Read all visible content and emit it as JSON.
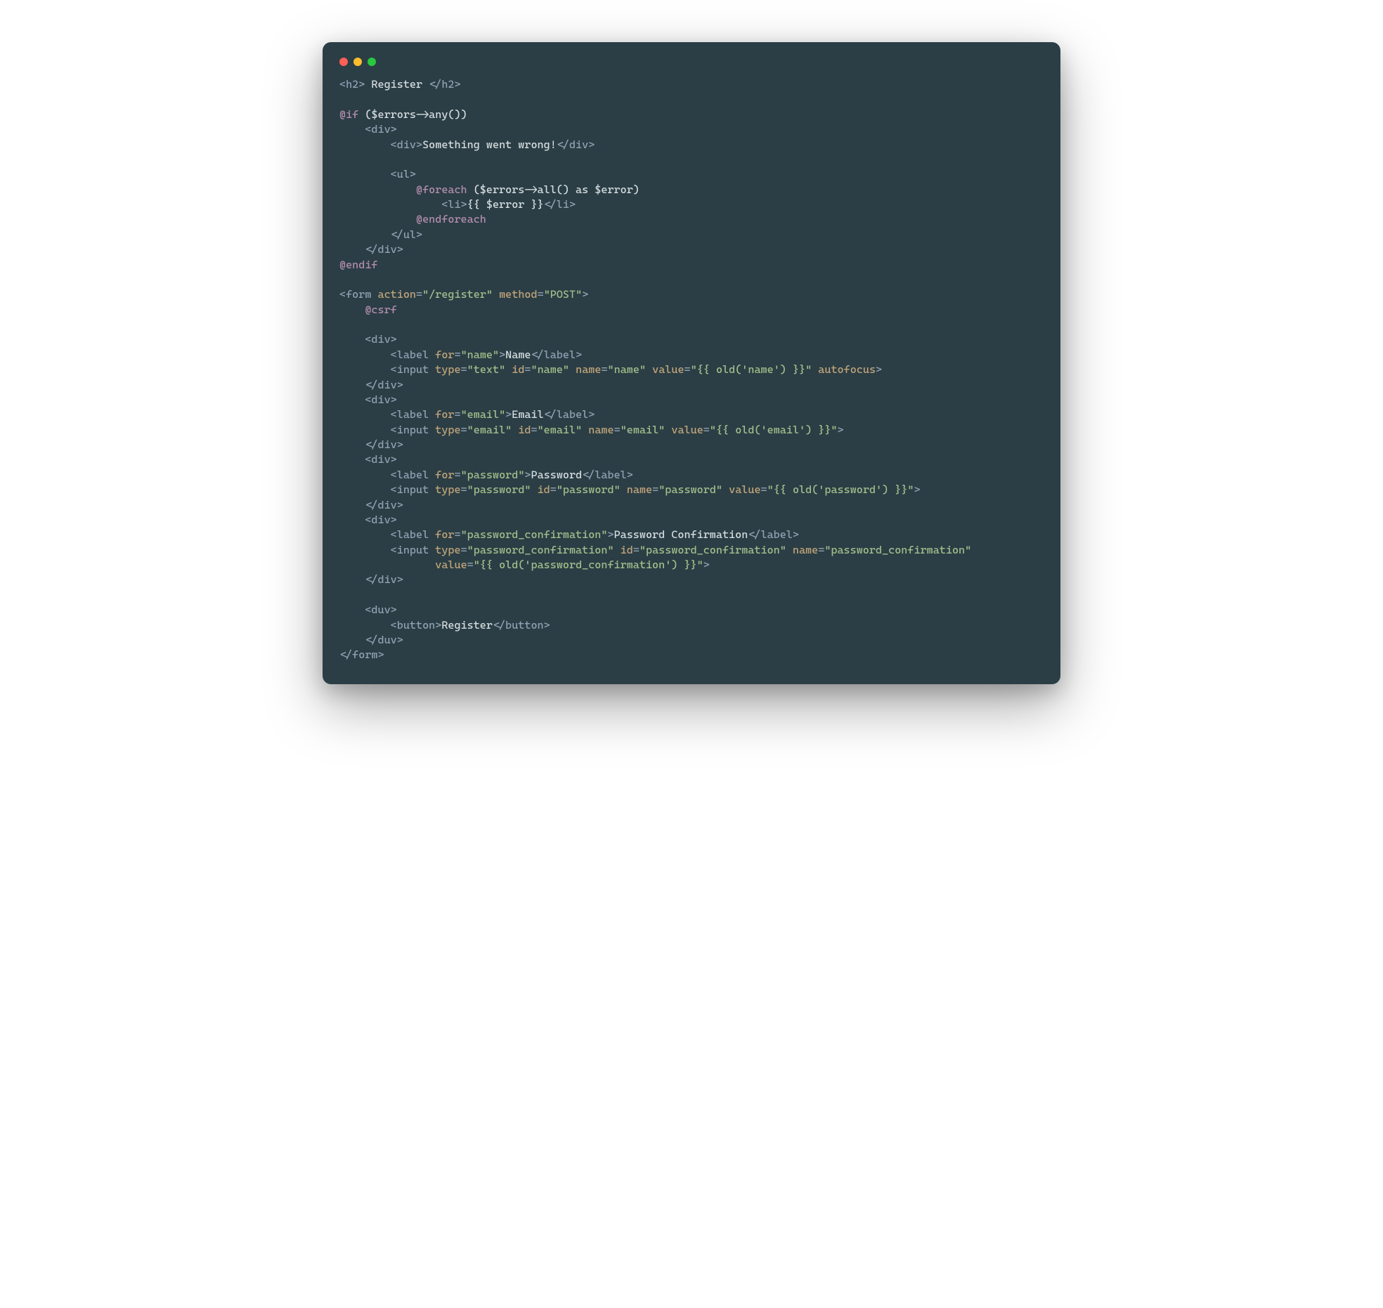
{
  "tokens": [
    [
      {
        "c": "tag",
        "t": "<h2>"
      },
      {
        "c": "txt",
        "t": " Register "
      },
      {
        "c": "tag",
        "t": "</h2>"
      }
    ],
    [],
    [
      {
        "c": "dir",
        "t": "@if"
      },
      {
        "c": "txt",
        "t": " ($errors->any())"
      }
    ],
    [
      {
        "c": "txt",
        "t": "    "
      },
      {
        "c": "tag",
        "t": "<div>"
      }
    ],
    [
      {
        "c": "txt",
        "t": "        "
      },
      {
        "c": "tag",
        "t": "<div>"
      },
      {
        "c": "txt",
        "t": "Something went wrong!"
      },
      {
        "c": "tag",
        "t": "</div>"
      }
    ],
    [],
    [
      {
        "c": "txt",
        "t": "        "
      },
      {
        "c": "tag",
        "t": "<ul>"
      }
    ],
    [
      {
        "c": "txt",
        "t": "            "
      },
      {
        "c": "dir",
        "t": "@foreach"
      },
      {
        "c": "txt",
        "t": " ($errors->all() as $error)"
      }
    ],
    [
      {
        "c": "txt",
        "t": "                "
      },
      {
        "c": "tag",
        "t": "<li>"
      },
      {
        "c": "txt",
        "t": "{{ $error }}"
      },
      {
        "c": "tag",
        "t": "</li>"
      }
    ],
    [
      {
        "c": "txt",
        "t": "            "
      },
      {
        "c": "dir",
        "t": "@endforeach"
      }
    ],
    [
      {
        "c": "txt",
        "t": "        "
      },
      {
        "c": "tag",
        "t": "</ul>"
      }
    ],
    [
      {
        "c": "txt",
        "t": "    "
      },
      {
        "c": "tag",
        "t": "</div>"
      }
    ],
    [
      {
        "c": "dir",
        "t": "@endif"
      }
    ],
    [],
    [
      {
        "c": "tag",
        "t": "<form "
      },
      {
        "c": "attr",
        "t": "action"
      },
      {
        "c": "tag",
        "t": "="
      },
      {
        "c": "str",
        "t": "\"/register\""
      },
      {
        "c": "tag",
        "t": " "
      },
      {
        "c": "attr",
        "t": "method"
      },
      {
        "c": "tag",
        "t": "="
      },
      {
        "c": "str",
        "t": "\"POST\""
      },
      {
        "c": "tag",
        "t": ">"
      }
    ],
    [
      {
        "c": "txt",
        "t": "    "
      },
      {
        "c": "dir",
        "t": "@csrf"
      }
    ],
    [],
    [
      {
        "c": "txt",
        "t": "    "
      },
      {
        "c": "tag",
        "t": "<div>"
      }
    ],
    [
      {
        "c": "txt",
        "t": "        "
      },
      {
        "c": "tag",
        "t": "<label "
      },
      {
        "c": "attr",
        "t": "for"
      },
      {
        "c": "tag",
        "t": "="
      },
      {
        "c": "str",
        "t": "\"name\""
      },
      {
        "c": "tag",
        "t": ">"
      },
      {
        "c": "txt",
        "t": "Name"
      },
      {
        "c": "tag",
        "t": "</label>"
      }
    ],
    [
      {
        "c": "txt",
        "t": "        "
      },
      {
        "c": "tag",
        "t": "<input "
      },
      {
        "c": "attr",
        "t": "type"
      },
      {
        "c": "tag",
        "t": "="
      },
      {
        "c": "str",
        "t": "\"text\""
      },
      {
        "c": "tag",
        "t": " "
      },
      {
        "c": "attr",
        "t": "id"
      },
      {
        "c": "tag",
        "t": "="
      },
      {
        "c": "str",
        "t": "\"name\""
      },
      {
        "c": "tag",
        "t": " "
      },
      {
        "c": "attr",
        "t": "name"
      },
      {
        "c": "tag",
        "t": "="
      },
      {
        "c": "str",
        "t": "\"name\""
      },
      {
        "c": "tag",
        "t": " "
      },
      {
        "c": "attr",
        "t": "value"
      },
      {
        "c": "tag",
        "t": "="
      },
      {
        "c": "str",
        "t": "\"{{ old('name') }}\""
      },
      {
        "c": "tag",
        "t": " "
      },
      {
        "c": "attr",
        "t": "autofocus"
      },
      {
        "c": "tag",
        "t": ">"
      }
    ],
    [
      {
        "c": "txt",
        "t": "    "
      },
      {
        "c": "tag",
        "t": "</div>"
      }
    ],
    [
      {
        "c": "txt",
        "t": "    "
      },
      {
        "c": "tag",
        "t": "<div>"
      }
    ],
    [
      {
        "c": "txt",
        "t": "        "
      },
      {
        "c": "tag",
        "t": "<label "
      },
      {
        "c": "attr",
        "t": "for"
      },
      {
        "c": "tag",
        "t": "="
      },
      {
        "c": "str",
        "t": "\"email\""
      },
      {
        "c": "tag",
        "t": ">"
      },
      {
        "c": "txt",
        "t": "Email"
      },
      {
        "c": "tag",
        "t": "</label>"
      }
    ],
    [
      {
        "c": "txt",
        "t": "        "
      },
      {
        "c": "tag",
        "t": "<input "
      },
      {
        "c": "attr",
        "t": "type"
      },
      {
        "c": "tag",
        "t": "="
      },
      {
        "c": "str",
        "t": "\"email\""
      },
      {
        "c": "tag",
        "t": " "
      },
      {
        "c": "attr",
        "t": "id"
      },
      {
        "c": "tag",
        "t": "="
      },
      {
        "c": "str",
        "t": "\"email\""
      },
      {
        "c": "tag",
        "t": " "
      },
      {
        "c": "attr",
        "t": "name"
      },
      {
        "c": "tag",
        "t": "="
      },
      {
        "c": "str",
        "t": "\"email\""
      },
      {
        "c": "tag",
        "t": " "
      },
      {
        "c": "attr",
        "t": "value"
      },
      {
        "c": "tag",
        "t": "="
      },
      {
        "c": "str",
        "t": "\"{{ old('email') }}\""
      },
      {
        "c": "tag",
        "t": ">"
      }
    ],
    [
      {
        "c": "txt",
        "t": "    "
      },
      {
        "c": "tag",
        "t": "</div>"
      }
    ],
    [
      {
        "c": "txt",
        "t": "    "
      },
      {
        "c": "tag",
        "t": "<div>"
      }
    ],
    [
      {
        "c": "txt",
        "t": "        "
      },
      {
        "c": "tag",
        "t": "<label "
      },
      {
        "c": "attr",
        "t": "for"
      },
      {
        "c": "tag",
        "t": "="
      },
      {
        "c": "str",
        "t": "\"password\""
      },
      {
        "c": "tag",
        "t": ">"
      },
      {
        "c": "txt",
        "t": "Password"
      },
      {
        "c": "tag",
        "t": "</label>"
      }
    ],
    [
      {
        "c": "txt",
        "t": "        "
      },
      {
        "c": "tag",
        "t": "<input "
      },
      {
        "c": "attr",
        "t": "type"
      },
      {
        "c": "tag",
        "t": "="
      },
      {
        "c": "str",
        "t": "\"password\""
      },
      {
        "c": "tag",
        "t": " "
      },
      {
        "c": "attr",
        "t": "id"
      },
      {
        "c": "tag",
        "t": "="
      },
      {
        "c": "str",
        "t": "\"password\""
      },
      {
        "c": "tag",
        "t": " "
      },
      {
        "c": "attr",
        "t": "name"
      },
      {
        "c": "tag",
        "t": "="
      },
      {
        "c": "str",
        "t": "\"password\""
      },
      {
        "c": "tag",
        "t": " "
      },
      {
        "c": "attr",
        "t": "value"
      },
      {
        "c": "tag",
        "t": "="
      },
      {
        "c": "str",
        "t": "\"{{ old('password') }}\""
      },
      {
        "c": "tag",
        "t": ">"
      }
    ],
    [
      {
        "c": "txt",
        "t": "    "
      },
      {
        "c": "tag",
        "t": "</div>"
      }
    ],
    [
      {
        "c": "txt",
        "t": "    "
      },
      {
        "c": "tag",
        "t": "<div>"
      }
    ],
    [
      {
        "c": "txt",
        "t": "        "
      },
      {
        "c": "tag",
        "t": "<label "
      },
      {
        "c": "attr",
        "t": "for"
      },
      {
        "c": "tag",
        "t": "="
      },
      {
        "c": "str",
        "t": "\"password_confirmation\""
      },
      {
        "c": "tag",
        "t": ">"
      },
      {
        "c": "txt",
        "t": "Password Confirmation"
      },
      {
        "c": "tag",
        "t": "</label>"
      }
    ],
    [
      {
        "c": "txt",
        "t": "        "
      },
      {
        "c": "tag",
        "t": "<input "
      },
      {
        "c": "attr",
        "t": "type"
      },
      {
        "c": "tag",
        "t": "="
      },
      {
        "c": "str",
        "t": "\"password_confirmation\""
      },
      {
        "c": "tag",
        "t": " "
      },
      {
        "c": "attr",
        "t": "id"
      },
      {
        "c": "tag",
        "t": "="
      },
      {
        "c": "str",
        "t": "\"password_confirmation\""
      },
      {
        "c": "tag",
        "t": " "
      },
      {
        "c": "attr",
        "t": "name"
      },
      {
        "c": "tag",
        "t": "="
      },
      {
        "c": "str",
        "t": "\"password_confirmation\""
      }
    ],
    [
      {
        "c": "txt",
        "t": "               "
      },
      {
        "c": "attr",
        "t": "value"
      },
      {
        "c": "tag",
        "t": "="
      },
      {
        "c": "str",
        "t": "\"{{ old('password_confirmation') }}\""
      },
      {
        "c": "tag",
        "t": ">"
      }
    ],
    [
      {
        "c": "txt",
        "t": "    "
      },
      {
        "c": "tag",
        "t": "</div>"
      }
    ],
    [],
    [
      {
        "c": "txt",
        "t": "    "
      },
      {
        "c": "tag",
        "t": "<duv>"
      }
    ],
    [
      {
        "c": "txt",
        "t": "        "
      },
      {
        "c": "tag",
        "t": "<button>"
      },
      {
        "c": "txt",
        "t": "Register"
      },
      {
        "c": "tag",
        "t": "</button>"
      }
    ],
    [
      {
        "c": "txt",
        "t": "    "
      },
      {
        "c": "tag",
        "t": "</duv>"
      }
    ],
    [
      {
        "c": "tag",
        "t": "</form>"
      }
    ]
  ]
}
